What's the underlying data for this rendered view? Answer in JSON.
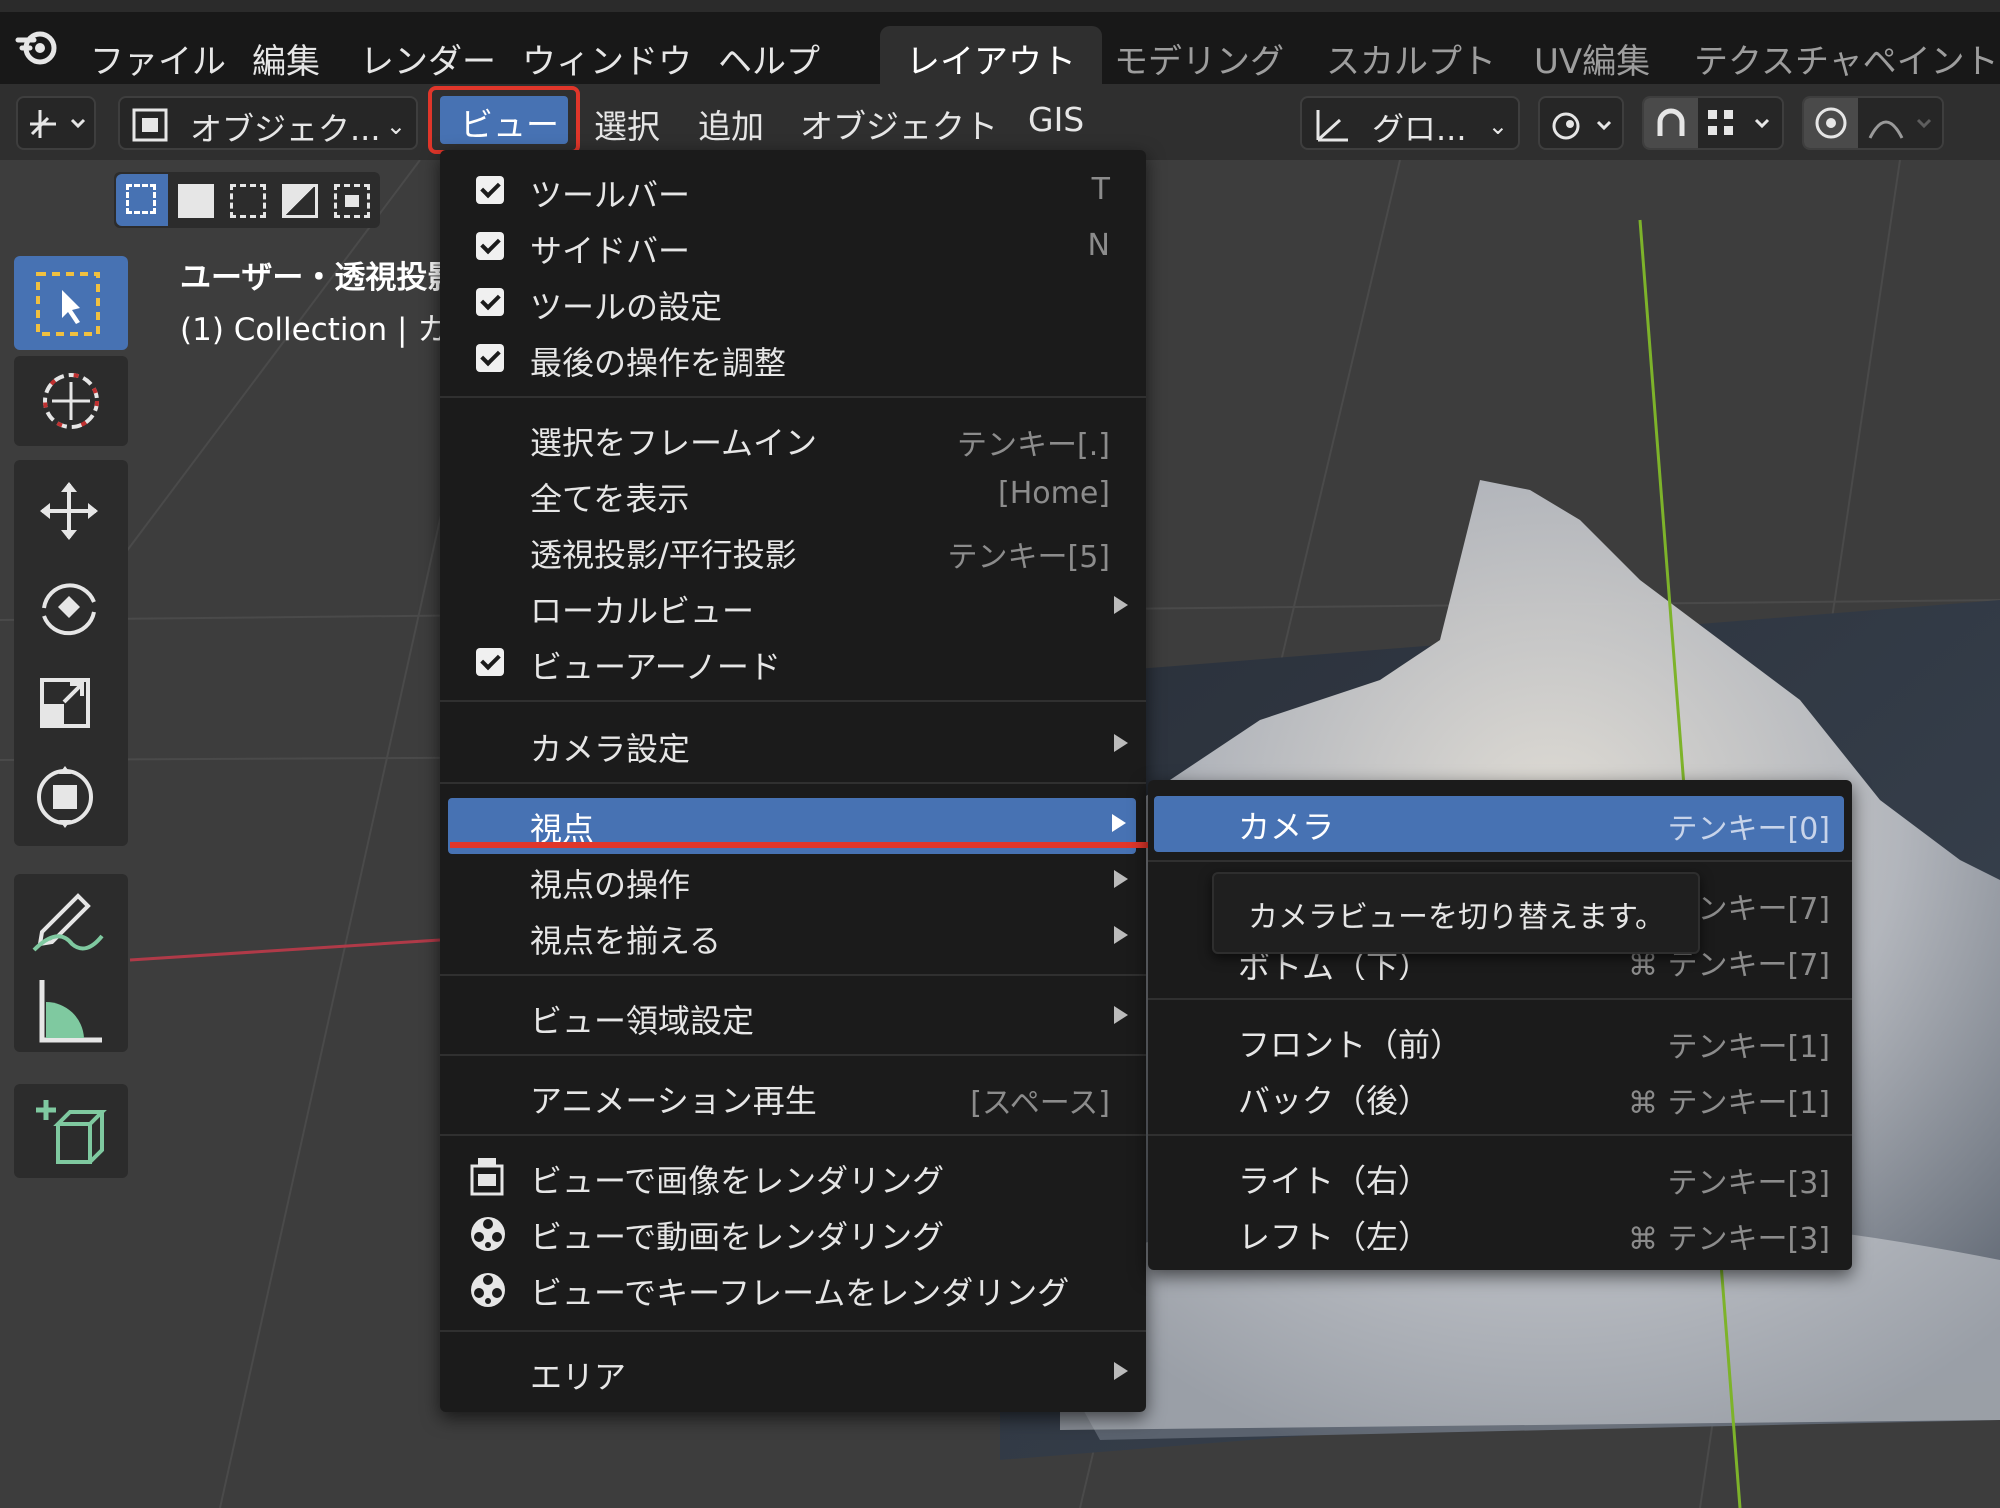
{
  "topbar": {
    "menus": [
      "ファイル",
      "編集",
      "レンダー",
      "ウィンドウ",
      "ヘルプ"
    ],
    "workspaces": [
      "レイアウト",
      "モデリング",
      "スカルプト",
      "UV編集",
      "テクスチャペイント"
    ],
    "active_workspace": "レイアウト"
  },
  "header": {
    "mode_label": "オブジェク...",
    "menus": [
      "ビュー",
      "選択",
      "追加",
      "オブジェクト",
      "GIS"
    ],
    "highlighted_menu": "ビュー",
    "transform_orientation": "グロ..."
  },
  "viewport": {
    "view_name": "ユーザー・透視投影",
    "collection_text": "(1) Collection | カ"
  },
  "view_menu": {
    "checkbox_items": [
      {
        "label": "ツールバー",
        "shortcut": "T"
      },
      {
        "label": "サイドバー",
        "shortcut": "N"
      },
      {
        "label": "ツールの設定",
        "shortcut": ""
      },
      {
        "label": "最後の操作を調整",
        "shortcut": ""
      }
    ],
    "group2": [
      {
        "label": "選択をフレームイン",
        "shortcut": "テンキー[.]"
      },
      {
        "label": "全てを表示",
        "shortcut": "[Home]"
      },
      {
        "label": "透視投影/平行投影",
        "shortcut": "テンキー[5]"
      },
      {
        "label": "ローカルビュー",
        "shortcut": ""
      },
      {
        "label": "ビューアーノード",
        "shortcut": ""
      }
    ],
    "camera_settings": "カメラ設定",
    "group4": [
      "視点",
      "視点の操作",
      "視点を揃える"
    ],
    "view_region": "ビュー領域設定",
    "animation": {
      "label": "アニメーション再生",
      "shortcut": "[スペース]"
    },
    "render_items": [
      "ビューで画像をレンダリング",
      "ビューで動画をレンダリング",
      "ビューでキーフレームをレンダリング"
    ],
    "area": "エリア"
  },
  "viewpoint_submenu": {
    "camera": {
      "label": "カメラ",
      "shortcut": "テンキー[0]"
    },
    "partial1": {
      "shortcut": "ンキー[7]"
    },
    "partial2": {
      "label": "ボトム（下）",
      "shortcut": "⌘ テンキー[7]"
    },
    "items": [
      {
        "label": "フロント（前）",
        "shortcut": "テンキー[1]"
      },
      {
        "label": "バック（後）",
        "shortcut": "⌘ テンキー[1]"
      },
      {
        "label": "ライト（右）",
        "shortcut": "テンキー[3]"
      },
      {
        "label": "レフト（左）",
        "shortcut": "⌘ テンキー[3]"
      }
    ]
  },
  "tooltip": "カメラビューを切り替えます。",
  "colors": {
    "accent_blue": "#4772b3",
    "highlight_red": "#e0362a",
    "menu_bg": "#1b1b1b",
    "viewport_bg": "#3d3d3d"
  }
}
